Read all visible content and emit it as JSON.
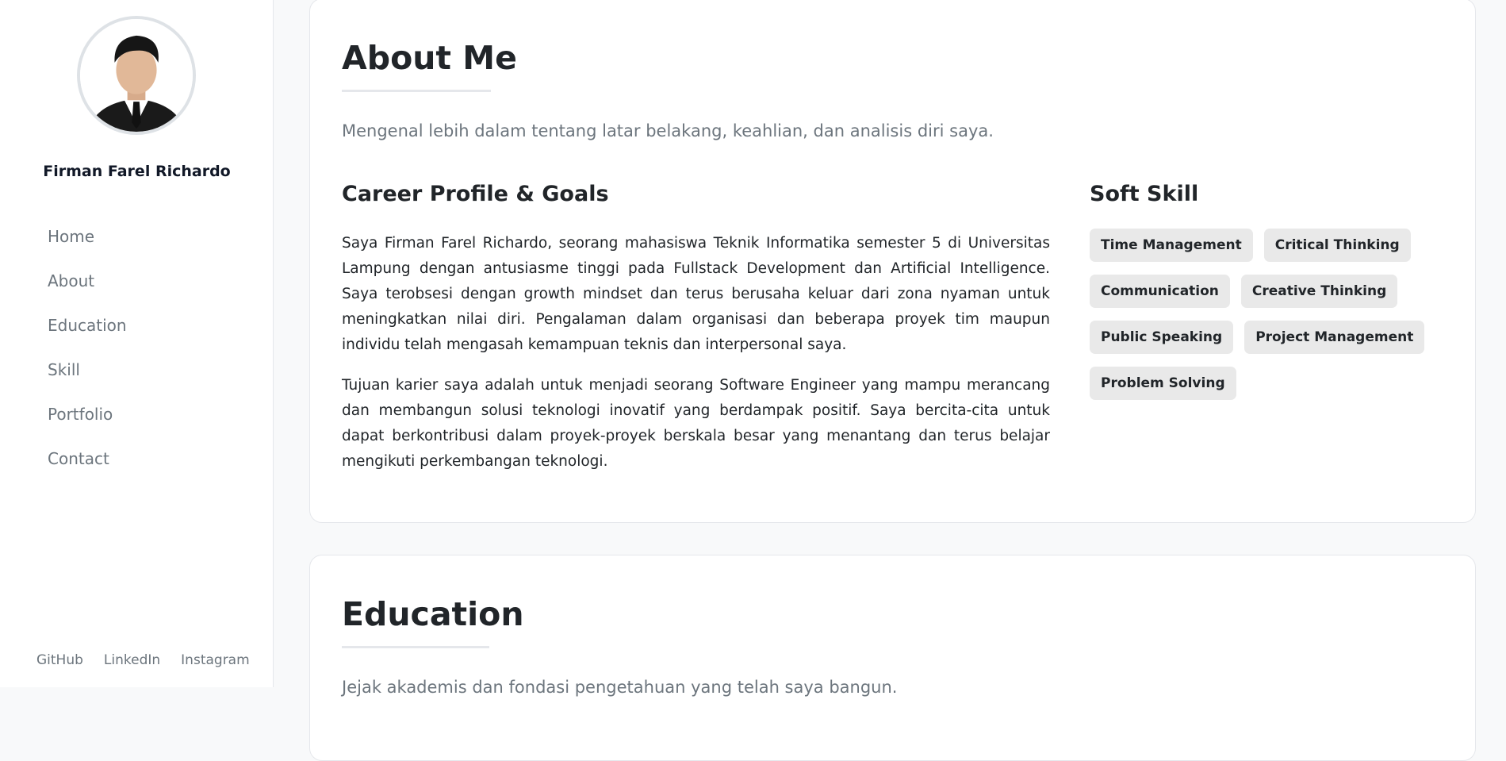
{
  "sidebar": {
    "name": "Firman Farel Richardo",
    "nav": [
      "Home",
      "About",
      "Education",
      "Skill",
      "Portfolio",
      "Contact"
    ],
    "socials": [
      "GitHub",
      "LinkedIn",
      "Instagram"
    ]
  },
  "about": {
    "title": "About Me",
    "subtitle": "Mengenal lebih dalam tentang latar belakang, keahlian, dan analisis diri saya.",
    "career_heading": "Career Profile & Goals",
    "paragraph1": "Saya Firman Farel Richardo, seorang mahasiswa Teknik Informatika semester 5 di Universitas Lampung dengan antusiasme tinggi pada Fullstack Development dan Artificial Intelligence. Saya terobsesi dengan growth mindset dan terus berusaha keluar dari zona nyaman untuk meningkatkan nilai diri. Pengalaman dalam organisasi dan beberapa proyek tim maupun individu telah mengasah kemampuan teknis dan interpersonal saya.",
    "paragraph2": "Tujuan karier saya adalah untuk menjadi seorang Software Engineer yang mampu merancang dan membangun solusi teknologi inovatif yang berdampak positif. Saya bercita-cita untuk dapat berkontribusi dalam proyek-proyek berskala besar yang menantang dan terus belajar mengikuti perkembangan teknologi.",
    "soft_skill_heading": "Soft Skill",
    "soft_skills": [
      "Time Management",
      "Critical Thinking",
      "Communication",
      "Creative Thinking",
      "Public Speaking",
      "Project Management",
      "Problem Solving"
    ]
  },
  "education": {
    "title": "Education",
    "subtitle": "Jejak akademis dan fondasi pengetahuan yang telah saya bangun."
  },
  "colors": {
    "background": "#f8f9fa",
    "card": "#ffffff",
    "chip": "#e9e9e9",
    "muted_text": "#6c757d",
    "border": "#e5e7eb"
  }
}
